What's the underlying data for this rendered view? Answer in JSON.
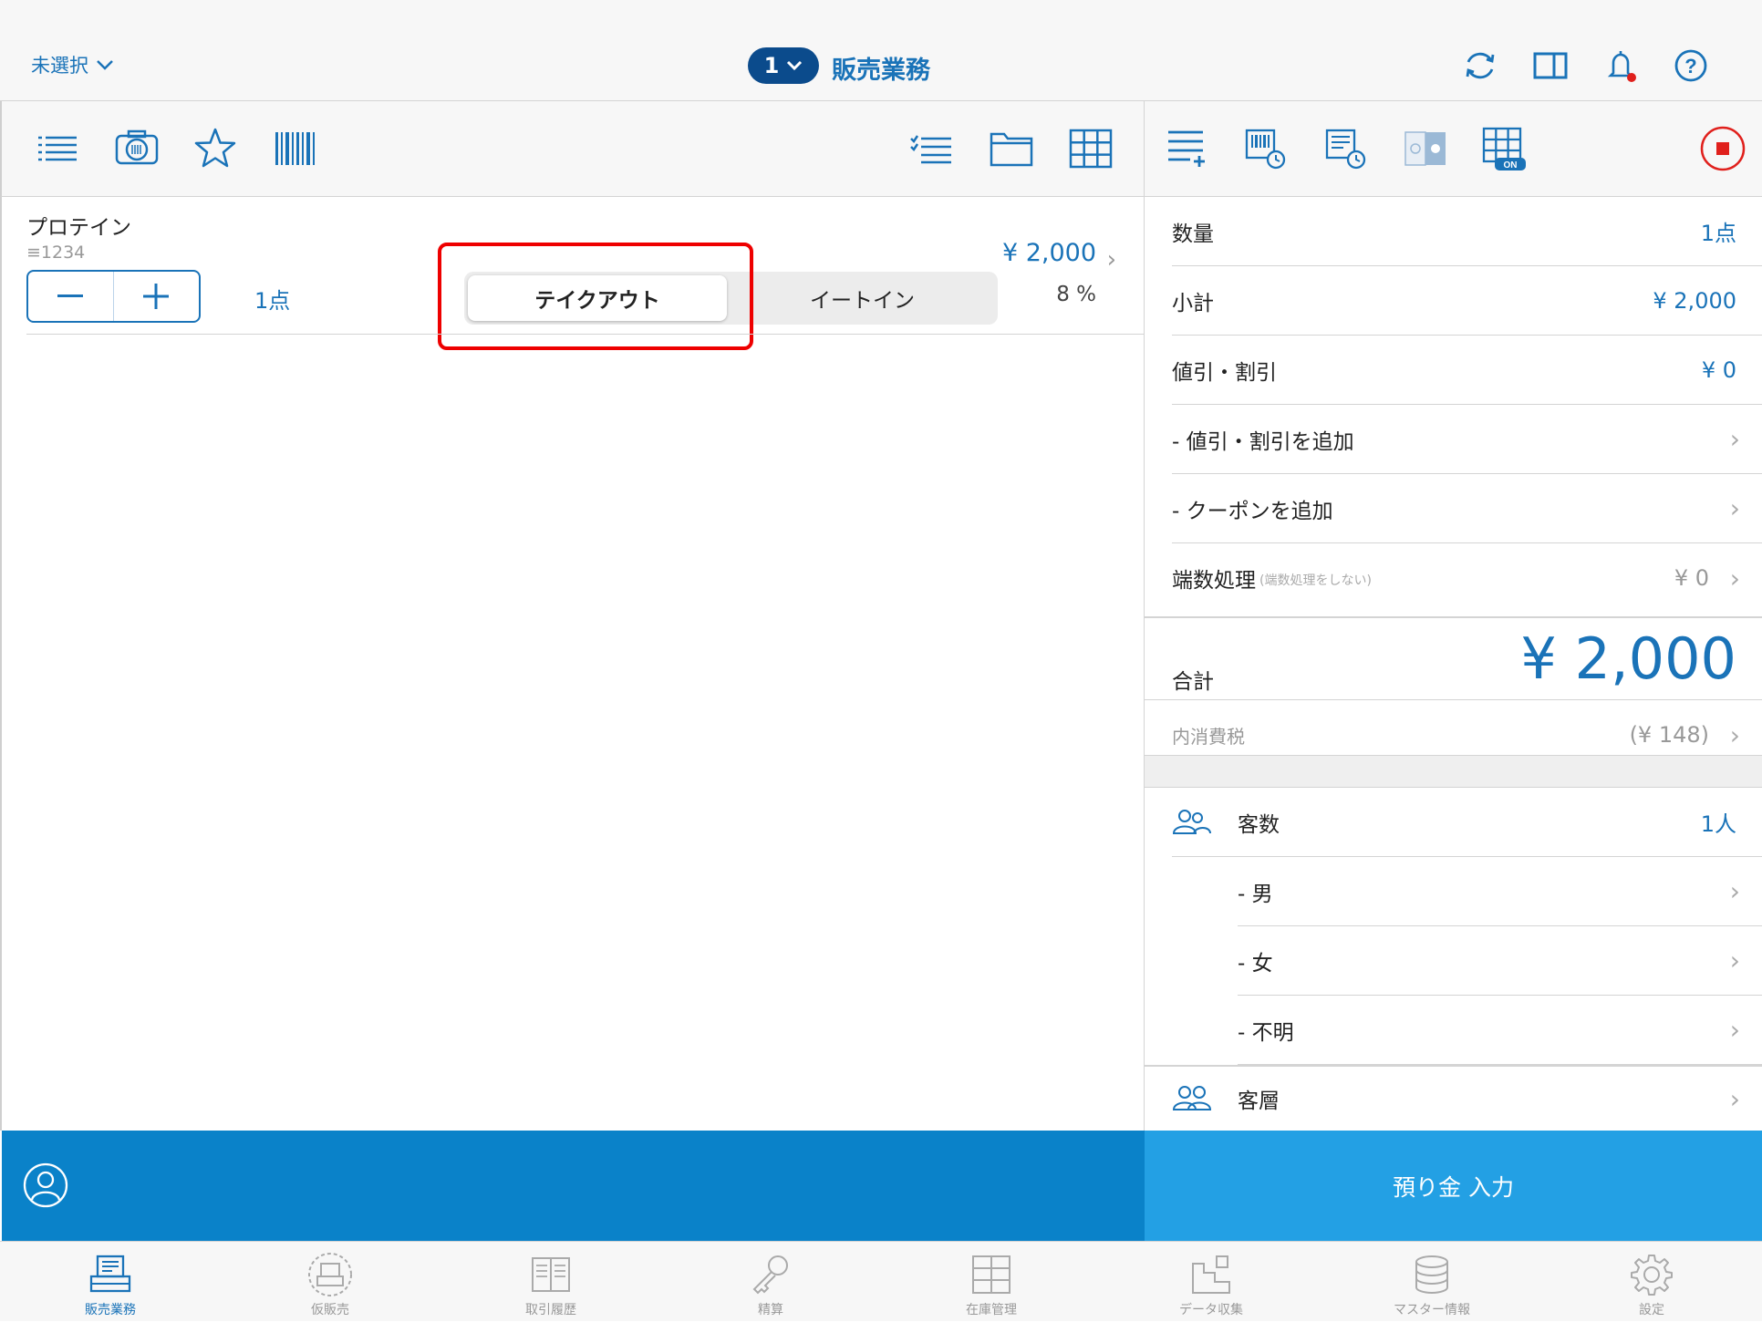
{
  "header": {
    "selector_label": "未選択",
    "register_number": "1",
    "title": "販売業務"
  },
  "item": {
    "name": "プロテイン",
    "code": "≡1234",
    "quantity": "1点",
    "price": "¥ 2,000",
    "tax_rate": "8 %",
    "take_out": "テイクアウト",
    "eat_in": "イートイン"
  },
  "summary": {
    "qty_label": "数量",
    "qty_value": "1点",
    "subtotal_label": "小計",
    "subtotal_value": "¥ 2,000",
    "discount_label": "値引・割引",
    "discount_value": "¥ 0",
    "add_discount": "- 値引・割引を追加",
    "add_coupon": "- クーポンを追加",
    "rounding_label": "端数処理",
    "rounding_sub": "(端数処理をしない)",
    "rounding_value": "¥ 0",
    "total_label": "合計",
    "total_value": "¥ 2,000",
    "tax_label": "内消費税",
    "tax_value": "(¥ 148)"
  },
  "customers": {
    "count_label": "客数",
    "count_value": "1人",
    "male": "- 男",
    "female": "- 女",
    "unknown": "- 不明",
    "segment_label": "客層"
  },
  "deposit_button": "預り金 入力",
  "tabs": [
    {
      "label": "販売業務"
    },
    {
      "label": "仮販売"
    },
    {
      "label": "取引履歴"
    },
    {
      "label": "精算"
    },
    {
      "label": "在庫管理"
    },
    {
      "label": "データ収集"
    },
    {
      "label": "マスター情報"
    },
    {
      "label": "設定"
    }
  ],
  "colors": {
    "accent": "#1a73b8",
    "bar_left": "#0a82c9",
    "bar_right": "#23a0e4",
    "highlight": "#e00000",
    "stop_red": "#e0201c"
  }
}
